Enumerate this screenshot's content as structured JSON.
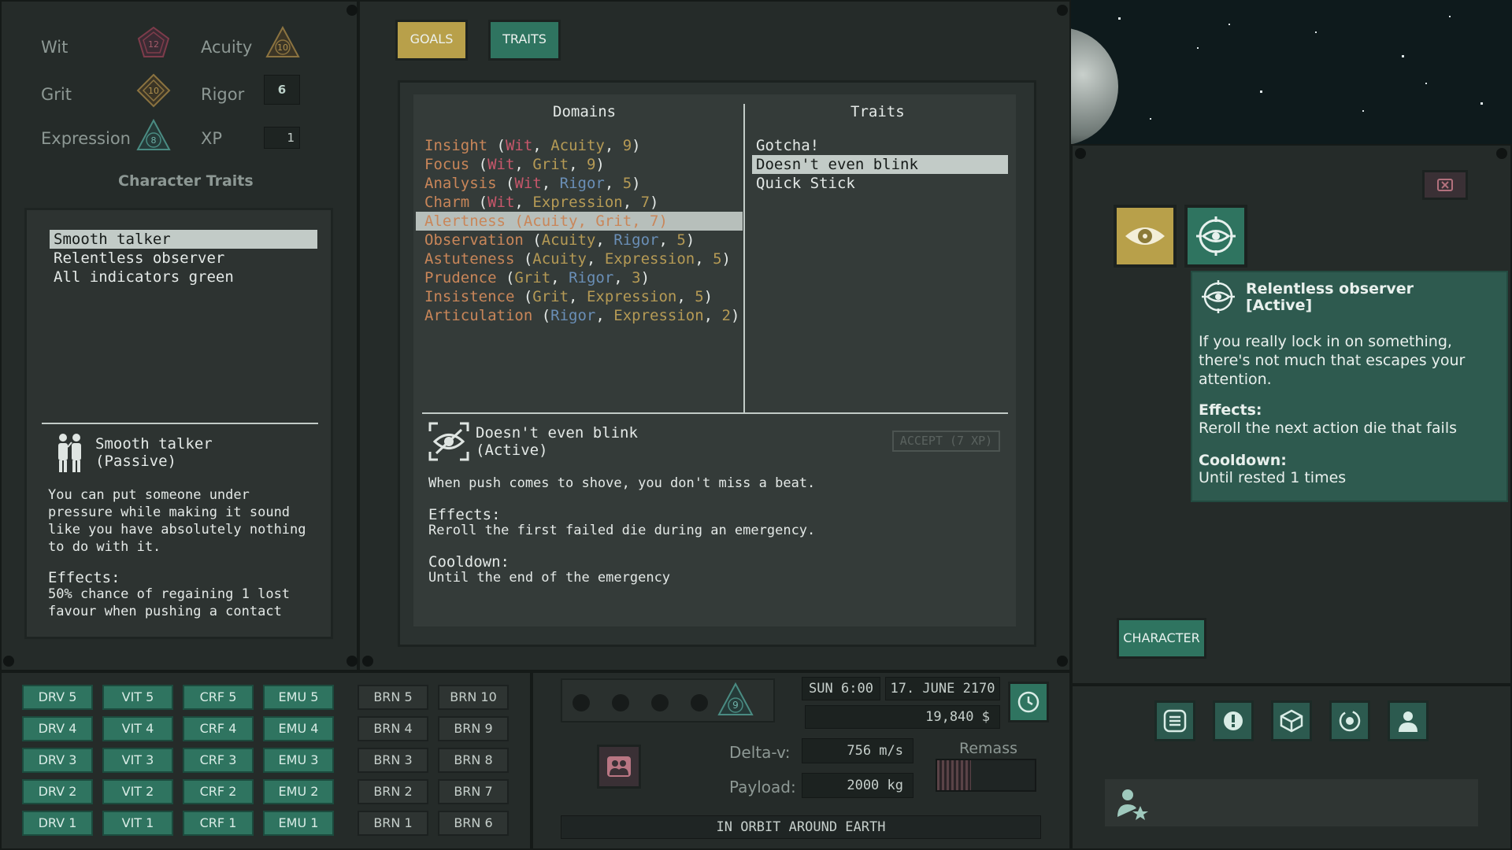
{
  "stats": {
    "wit": {
      "label": "Wit",
      "value": "12"
    },
    "acuity": {
      "label": "Acuity",
      "value": "10"
    },
    "grit": {
      "label": "Grit",
      "value": "10"
    },
    "rigor": {
      "label": "Rigor",
      "value": "6"
    },
    "expression": {
      "label": "Expression",
      "value": "8"
    },
    "xp": {
      "label": "XP",
      "value": "1"
    }
  },
  "character_traits": {
    "title": "Character Traits",
    "items": [
      "Smooth talker",
      "Relentless observer",
      "All indicators green"
    ],
    "selected_index": 0,
    "detail": {
      "name": "Smooth talker",
      "status": "(Passive)",
      "description": "You can put someone under pressure while making it sound like you have absolutely nothing to do with it.",
      "effects_label": "Effects:",
      "effects": "50% chance of regaining 1 lost favour when pushing a contact"
    }
  },
  "tabs": {
    "goals": "GOALS",
    "traits": "TRAITS"
  },
  "domains": {
    "header": "Domains",
    "rows": [
      {
        "name": "Insight",
        "a": "Wit",
        "b": "Acuity",
        "n": "9"
      },
      {
        "name": "Focus",
        "a": "Wit",
        "b": "Grit",
        "n": "9"
      },
      {
        "name": "Analysis",
        "a": "Wit",
        "b": "Rigor",
        "n": "5"
      },
      {
        "name": "Charm",
        "a": "Wit",
        "b": "Expression",
        "n": "7"
      },
      {
        "name": "Alertness",
        "a": "Acuity",
        "b": "Grit",
        "n": "7"
      },
      {
        "name": "Observation",
        "a": "Acuity",
        "b": "Rigor",
        "n": "5"
      },
      {
        "name": "Astuteness",
        "a": "Acuity",
        "b": "Expression",
        "n": "5"
      },
      {
        "name": "Prudence",
        "a": "Grit",
        "b": "Rigor",
        "n": "3"
      },
      {
        "name": "Insistence",
        "a": "Grit",
        "b": "Expression",
        "n": "5"
      },
      {
        "name": "Articulation",
        "a": "Rigor",
        "b": "Expression",
        "n": "2"
      }
    ],
    "selected_index": 4
  },
  "traits_list": {
    "header": "Traits",
    "items": [
      "Gotcha!",
      "Doesn't even blink",
      "Quick Stick"
    ],
    "selected_index": 1
  },
  "trait_detail": {
    "name": "Doesn't even blink",
    "status": "(Active)",
    "accept_label": "ACCEPT (7 XP)",
    "description": "When push comes to shove, you don't miss a beat.",
    "effects_label": "Effects:",
    "effects": "Reroll the first failed die during an emergency.",
    "cooldown_label": "Cooldown:",
    "cooldown": "Until the end of the emergency"
  },
  "tooltip": {
    "title": "Relentless observer",
    "status": "[Active]",
    "description": "If you really lock in on something, there's not much that escapes your attention.",
    "effects_label": "Effects:",
    "effects": "Reroll the next action die that fails",
    "cooldown_label": "Cooldown:",
    "cooldown": "Until rested 1 times"
  },
  "character_button": "CHARACTER",
  "skill_buttons": {
    "drv": [
      "DRV 5",
      "DRV 4",
      "DRV 3",
      "DRV 2",
      "DRV 1"
    ],
    "vit": [
      "VIT 5",
      "VIT 4",
      "VIT 3",
      "VIT 2",
      "VIT 1"
    ],
    "crf": [
      "CRF 5",
      "CRF 4",
      "CRF 3",
      "CRF 2",
      "CRF 1"
    ],
    "emu": [
      "EMU 5",
      "EMU 4",
      "EMU 3",
      "EMU 2",
      "EMU 1"
    ],
    "brn_a": [
      "BRN 5",
      "BRN 4",
      "BRN 3",
      "BRN 2",
      "BRN 1"
    ],
    "brn_b": [
      "BRN 10",
      "BRN 9",
      "BRN 8",
      "BRN 7",
      "BRN 6"
    ]
  },
  "status": {
    "day_time": "SUN 6:00",
    "date": "17. JUNE 2170",
    "money": "19,840 $",
    "delta_v_label": "Delta-v:",
    "delta_v": "756 m/s",
    "payload_label": "Payload:",
    "payload": "2000 kg",
    "remass_label": "Remass",
    "remass_fill": 0.35,
    "location": "IN ORBIT AROUND EARTH",
    "badge_value": "9"
  },
  "colors": {
    "teal": "#2f7460",
    "gold": "#b8a04a",
    "tooltip_bg": "#2e5a4f"
  }
}
